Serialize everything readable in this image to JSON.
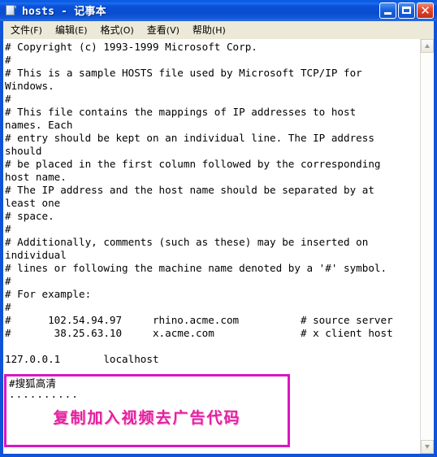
{
  "window": {
    "title": "hosts - 记事本",
    "icon": "notepad-document-icon",
    "buttons": {
      "minimize": "_",
      "maximize": "□",
      "close": "✕"
    }
  },
  "menubar": {
    "items": [
      {
        "label": "文件",
        "accel": "(F)"
      },
      {
        "label": "编辑",
        "accel": "(E)"
      },
      {
        "label": "格式",
        "accel": "(O)"
      },
      {
        "label": "查看",
        "accel": "(V)"
      },
      {
        "label": "帮助",
        "accel": "(H)"
      }
    ]
  },
  "editor": {
    "lines": [
      "# Copyright (c) 1993-1999 Microsoft Corp.",
      "#",
      "# This is a sample HOSTS file used by Microsoft TCP/IP for",
      "Windows.",
      "#",
      "# This file contains the mappings of IP addresses to host",
      "names. Each",
      "# entry should be kept on an individual line. The IP address",
      "should",
      "# be placed in the first column followed by the corresponding",
      "host name.",
      "# The IP address and the host name should be separated by at",
      "least one",
      "# space.",
      "#",
      "# Additionally, comments (such as these) may be inserted on",
      "individual",
      "# lines or following the machine name denoted by a '#' symbol.",
      "#",
      "# For example:",
      "#",
      "#      102.54.94.97     rhino.acme.com          # source server",
      "#       38.25.63.10     x.acme.com              # x client host",
      "",
      "127.0.0.1       localhost"
    ]
  },
  "annotation": {
    "highlight_color": "#d916c4",
    "comment_line": "#搜狐高清",
    "dots_line": "..........",
    "banner_text": "复制加入视频去广告代码",
    "banner_color": "#e1249f"
  },
  "scrollbar": {
    "up_arrow": "scroll-up-arrow",
    "down_arrow": "scroll-down-arrow"
  }
}
